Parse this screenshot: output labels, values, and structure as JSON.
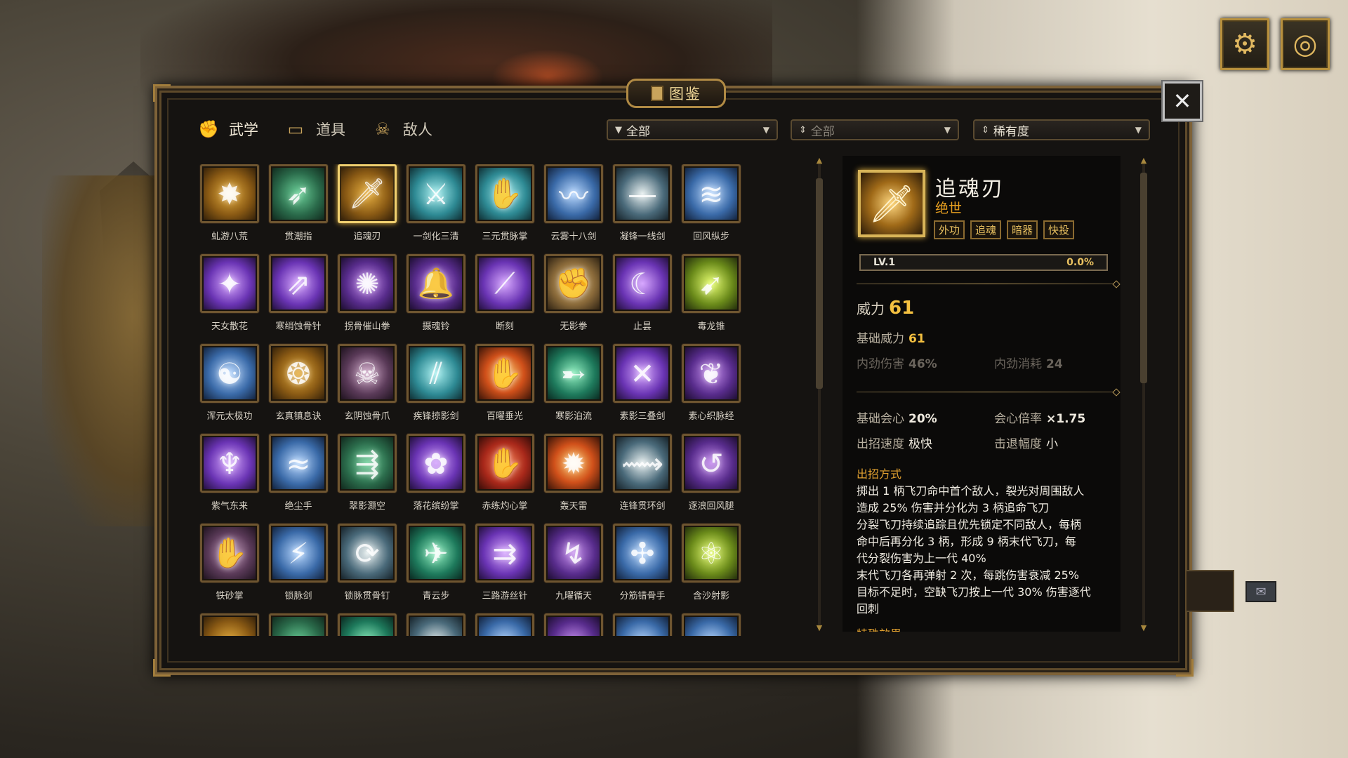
{
  "window": {
    "title": "图鉴"
  },
  "tabs": [
    {
      "label": "武学",
      "icon": "fist-icon",
      "glyph": "✊"
    },
    {
      "label": "道具",
      "icon": "chest-icon",
      "glyph": "▭"
    },
    {
      "label": "敌人",
      "icon": "skull-icon",
      "glyph": "☠"
    }
  ],
  "filters": [
    {
      "value": "全部",
      "lead": "▼"
    },
    {
      "value": "全部",
      "lead": "⇕"
    },
    {
      "value": "稀有度",
      "lead": "⇕"
    }
  ],
  "skills": [
    {
      "name": "虬游八荒",
      "theme": "t-gold",
      "glyph": "✸"
    },
    {
      "name": "贯潮指",
      "theme": "t-green",
      "glyph": "➶"
    },
    {
      "name": "追魂刃",
      "theme": "t-gold",
      "glyph": "🗡",
      "selected": true
    },
    {
      "name": "一剑化三清",
      "theme": "t-cyan",
      "glyph": "⚔"
    },
    {
      "name": "三元贯脉掌",
      "theme": "t-cyan",
      "glyph": "✋"
    },
    {
      "name": "云雾十八剑",
      "theme": "t-blue",
      "glyph": "〰"
    },
    {
      "name": "凝锋一线剑",
      "theme": "t-steel",
      "glyph": "—"
    },
    {
      "name": "回风纵步",
      "theme": "t-blue",
      "glyph": "≋"
    },
    {
      "name": "天女散花",
      "theme": "t-purple",
      "glyph": "✦"
    },
    {
      "name": "寒绡蚀骨针",
      "theme": "t-purple",
      "glyph": "⇗"
    },
    {
      "name": "拐骨催山拳",
      "theme": "t-violet",
      "glyph": "✺"
    },
    {
      "name": "摄魂铃",
      "theme": "t-violet",
      "glyph": "🔔"
    },
    {
      "name": "断刻",
      "theme": "t-purple",
      "glyph": "⟋"
    },
    {
      "name": "无影拳",
      "theme": "t-tan",
      "glyph": "✊"
    },
    {
      "name": "止昙",
      "theme": "t-purple",
      "glyph": "☾"
    },
    {
      "name": "毒龙锥",
      "theme": "t-lime",
      "glyph": "➹"
    },
    {
      "name": "浑元太极功",
      "theme": "t-blue",
      "glyph": "☯"
    },
    {
      "name": "玄真镇息诀",
      "theme": "t-gold",
      "glyph": "❂"
    },
    {
      "name": "玄阴蚀骨爪",
      "theme": "t-skull",
      "glyph": "☠"
    },
    {
      "name": "疾锋掠影剑",
      "theme": "t-cyan",
      "glyph": "⫽"
    },
    {
      "name": "百曜垂光",
      "theme": "t-fire",
      "glyph": "✋"
    },
    {
      "name": "寒影泊流",
      "theme": "t-teal",
      "glyph": "➸"
    },
    {
      "name": "素影三叠剑",
      "theme": "t-purple",
      "glyph": "✕"
    },
    {
      "name": "素心织脉经",
      "theme": "t-violet",
      "glyph": "❦"
    },
    {
      "name": "紫气东来",
      "theme": "t-purple",
      "glyph": "♆"
    },
    {
      "name": "绝尘手",
      "theme": "t-blue",
      "glyph": "≈"
    },
    {
      "name": "翠影灏空",
      "theme": "t-green",
      "glyph": "⇶"
    },
    {
      "name": "落花缤纷掌",
      "theme": "t-purple",
      "glyph": "✿"
    },
    {
      "name": "赤练灼心掌",
      "theme": "t-red",
      "glyph": "✋"
    },
    {
      "name": "轰天雷",
      "theme": "t-fire",
      "glyph": "✹"
    },
    {
      "name": "连锋贯环剑",
      "theme": "t-steel",
      "glyph": "⟿"
    },
    {
      "name": "逐浪回风腿",
      "theme": "t-violet",
      "glyph": "↺"
    },
    {
      "name": "铁砂掌",
      "theme": "t-skull",
      "glyph": "✋"
    },
    {
      "name": "锁脉剑",
      "theme": "t-blue",
      "glyph": "⚡"
    },
    {
      "name": "锁脉贯骨钉",
      "theme": "t-steel",
      "glyph": "⟳"
    },
    {
      "name": "青云步",
      "theme": "t-teal",
      "glyph": "✈"
    },
    {
      "name": "三路游丝针",
      "theme": "t-purple",
      "glyph": "⇉"
    },
    {
      "name": "九曜循天",
      "theme": "t-violet",
      "glyph": "↯"
    },
    {
      "name": "分筋错骨手",
      "theme": "t-blue",
      "glyph": "✣"
    },
    {
      "name": "含沙射影",
      "theme": "t-lime",
      "glyph": "⚛"
    },
    {
      "name": "",
      "theme": "t-gold",
      "glyph": ""
    },
    {
      "name": "",
      "theme": "t-green",
      "glyph": ""
    },
    {
      "name": "",
      "theme": "t-teal",
      "glyph": ""
    },
    {
      "name": "",
      "theme": "t-steel",
      "glyph": ""
    },
    {
      "name": "",
      "theme": "t-blue",
      "glyph": ""
    },
    {
      "name": "",
      "theme": "t-violet",
      "glyph": ""
    },
    {
      "name": "",
      "theme": "t-blue",
      "glyph": ""
    },
    {
      "name": "",
      "theme": "t-blue",
      "glyph": ""
    }
  ],
  "detail": {
    "name": "追魂刃",
    "rarity": "绝世",
    "tags": [
      "外功",
      "追魂",
      "暗器",
      "快投"
    ],
    "level": "LV.1",
    "exp_pct": "0.0%",
    "power_label": "威力",
    "power": "61",
    "base_power_label": "基础威力",
    "base_power": "61",
    "internal_damage_label": "内劲伤害",
    "internal_damage": "46%",
    "internal_cost_label": "内劲消耗",
    "internal_cost": "24",
    "base_crit_label": "基础会心",
    "base_crit": "20%",
    "crit_mult_label": "会心倍率",
    "crit_mult": "×1.75",
    "speed_label": "出招速度",
    "speed": "极快",
    "knockback_label": "击退幅度",
    "knockback": "小",
    "method_title": "出招方式",
    "description": [
      "掷出 1 柄飞刀命中首个敌人，裂光对周围敌人",
      "造成 25% 伤害并分化为 3 柄追命飞刀",
      "分裂飞刀持续追踪且优先锁定不同敌人，每柄",
      "命中后再分化 3 柄，形成 9 柄末代飞刀，每",
      "代分裂伤害为上一代 40%",
      "末代飞刀各再弹射 2 次，每跳伤害衰减 25%",
      "目标不足时，空缺飞刀按上一代 30% 伤害逐代",
      "回刺"
    ],
    "special_title": "特殊效果"
  },
  "colors": {
    "accent_gold": "#e0a030",
    "frame": "#7e6238",
    "panel_bg": "#151311"
  }
}
